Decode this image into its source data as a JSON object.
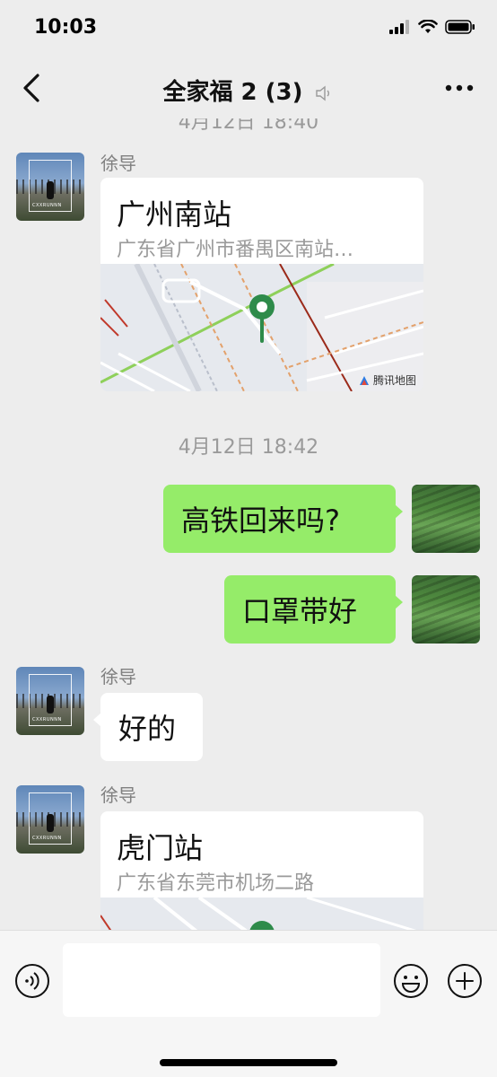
{
  "status": {
    "time": "10:03"
  },
  "nav": {
    "title": "全家福 2 (3)"
  },
  "chat": {
    "cut_timestamp": "4月12日 18:40",
    "messages": [
      {
        "sender": "徐导",
        "type": "location",
        "title": "广州南站",
        "address": "广东省广州市番禺区南站…",
        "map_credit": "腾讯地图"
      },
      {
        "timestamp": "4月12日 18:42"
      },
      {
        "self": true,
        "text": "高铁回来吗?"
      },
      {
        "self": true,
        "text": "口罩带好"
      },
      {
        "sender": "徐导",
        "type": "text",
        "text": "好的"
      },
      {
        "sender": "徐导",
        "type": "location",
        "title": "虎门站",
        "address": "广东省东莞市机场二路"
      }
    ]
  },
  "avatar_caption": "CXXRUNNN",
  "input": {
    "value": ""
  },
  "colors": {
    "bg": "#ededed",
    "bubble_self": "#95ec69",
    "bubble_other": "#ffffff",
    "map_pin": "#2e8b4a"
  }
}
